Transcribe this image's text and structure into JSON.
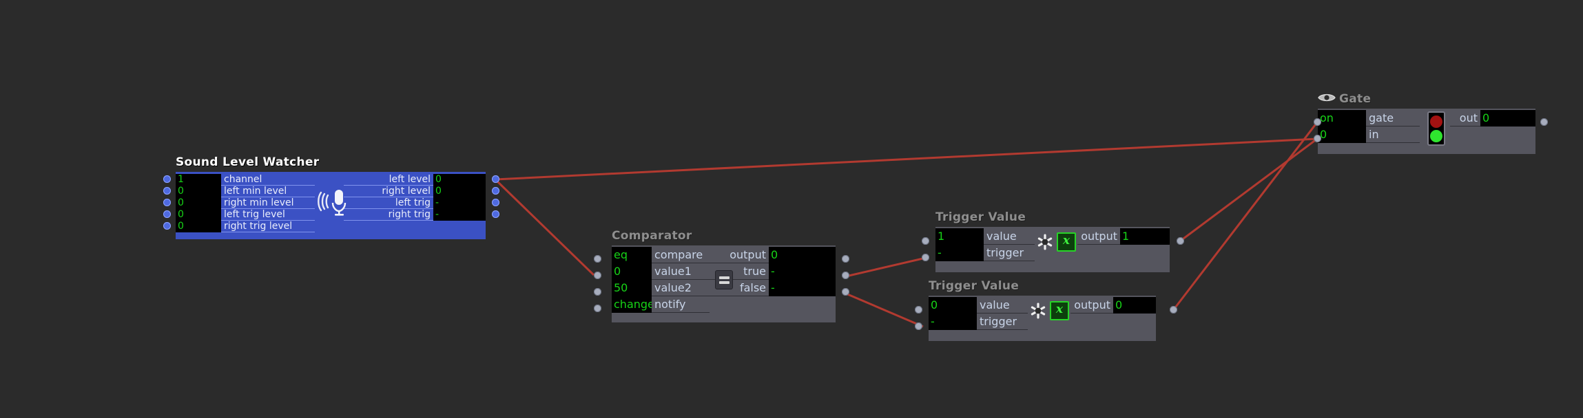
{
  "canvas": {
    "background": "#2b2b2b",
    "wire_color": "#b23a30",
    "socket_color": "#a7adbd",
    "socket_color_selected": "#4f6ae0"
  },
  "nodes": [
    {
      "id": "sound-level-watcher",
      "title": "Sound Level Watcher",
      "selected": true,
      "icon": "microphone-icon",
      "inputs": [
        {
          "label": "channel",
          "value": "1"
        },
        {
          "label": "left min level",
          "value": "0"
        },
        {
          "label": "right min level",
          "value": "0"
        },
        {
          "label": "left trig level",
          "value": "0"
        },
        {
          "label": "right trig level",
          "value": "0"
        }
      ],
      "outputs": [
        {
          "label": "left level",
          "value": "0"
        },
        {
          "label": "right level",
          "value": "0"
        },
        {
          "label": "left trig",
          "value": "-"
        },
        {
          "label": "right trig",
          "value": "-"
        }
      ]
    },
    {
      "id": "comparator",
      "title": "Comparator",
      "selected": false,
      "icon": "equals-icon",
      "inputs": [
        {
          "label": "compare",
          "value": "eq"
        },
        {
          "label": "value1",
          "value": "0"
        },
        {
          "label": "value2",
          "value": "50"
        },
        {
          "label": "notify",
          "value": "change"
        }
      ],
      "outputs": [
        {
          "label": "output",
          "value": "0"
        },
        {
          "label": "true",
          "value": "-"
        },
        {
          "label": "false",
          "value": "-"
        }
      ]
    },
    {
      "id": "trigger-value-1",
      "title": "Trigger Value",
      "selected": false,
      "icon": "expression-icon",
      "inputs": [
        {
          "label": "value",
          "value": "1"
        },
        {
          "label": "trigger",
          "value": "-"
        }
      ],
      "outputs": [
        {
          "label": "output",
          "value": "1"
        }
      ]
    },
    {
      "id": "trigger-value-2",
      "title": "Trigger Value",
      "selected": false,
      "icon": "expression-icon",
      "inputs": [
        {
          "label": "value",
          "value": "0"
        },
        {
          "label": "trigger",
          "value": "-"
        }
      ],
      "outputs": [
        {
          "label": "output",
          "value": "0"
        }
      ]
    },
    {
      "id": "gate",
      "title": "Gate",
      "selected": false,
      "icon": "traffic-light-icon",
      "title_icon": "eye-icon",
      "inputs": [
        {
          "label": "gate",
          "value": "on"
        },
        {
          "label": "in",
          "value": "0"
        }
      ],
      "outputs": [
        {
          "label": "out",
          "value": "0"
        }
      ]
    }
  ],
  "connections": [
    {
      "from": "sound-level-watcher.left level",
      "to": "comparator.value1"
    },
    {
      "from": "sound-level-watcher.left level",
      "to": "gate.in"
    },
    {
      "from": "comparator.true",
      "to": "trigger-value-1.trigger"
    },
    {
      "from": "comparator.false",
      "to": "trigger-value-2.trigger"
    },
    {
      "from": "trigger-value-1.output",
      "to": "gate.in"
    },
    {
      "from": "trigger-value-2.output",
      "to": "gate.on"
    }
  ]
}
